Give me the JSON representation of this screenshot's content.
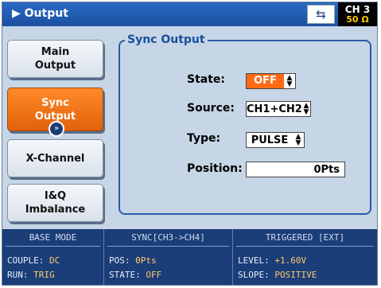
{
  "header": {
    "title": "Output",
    "title_marker": "▶",
    "usb_icon": "usb-icon",
    "channel": "CH 3",
    "impedance": "50 Ω"
  },
  "nav": {
    "main_output": [
      "Main",
      "Output"
    ],
    "sync_output": [
      "Sync",
      "Output"
    ],
    "x_channel": "X-Channel",
    "iq_imbalance": [
      "I&Q",
      "Imbalance"
    ],
    "expander_glyph": "»"
  },
  "sync_panel": {
    "title": "Sync Output",
    "state_label": "State:",
    "state_value": "OFF",
    "source_label": "Source:",
    "source_value": "CH1+CH2",
    "type_label": "Type:",
    "type_value": "PULSE",
    "position_label": "Position:",
    "position_value": "0Pts",
    "spinner_glyph": "▲▼"
  },
  "status": {
    "base_mode": {
      "header": "BASE MODE",
      "couple_label": "COUPLE:",
      "couple_value": "DC",
      "run_label": "RUN:",
      "run_value": "TRIG"
    },
    "sync": {
      "header": "SYNC[CH3->CH4]",
      "pos_label": "POS:",
      "pos_value": "0Pts",
      "state_label": "STATE:",
      "state_value": "OFF"
    },
    "triggered": {
      "header": "TRIGGERED [EXT]",
      "level_label": "LEVEL:",
      "level_value": "+1.60V",
      "slope_label": "SLOPE:",
      "slope_value": "POSITIVE"
    }
  },
  "colors": {
    "header_bg": "#1b4f9e",
    "active_button": "#ff6a14",
    "status_bg": "#1b3d78",
    "value_accent": "#ffcc66"
  }
}
